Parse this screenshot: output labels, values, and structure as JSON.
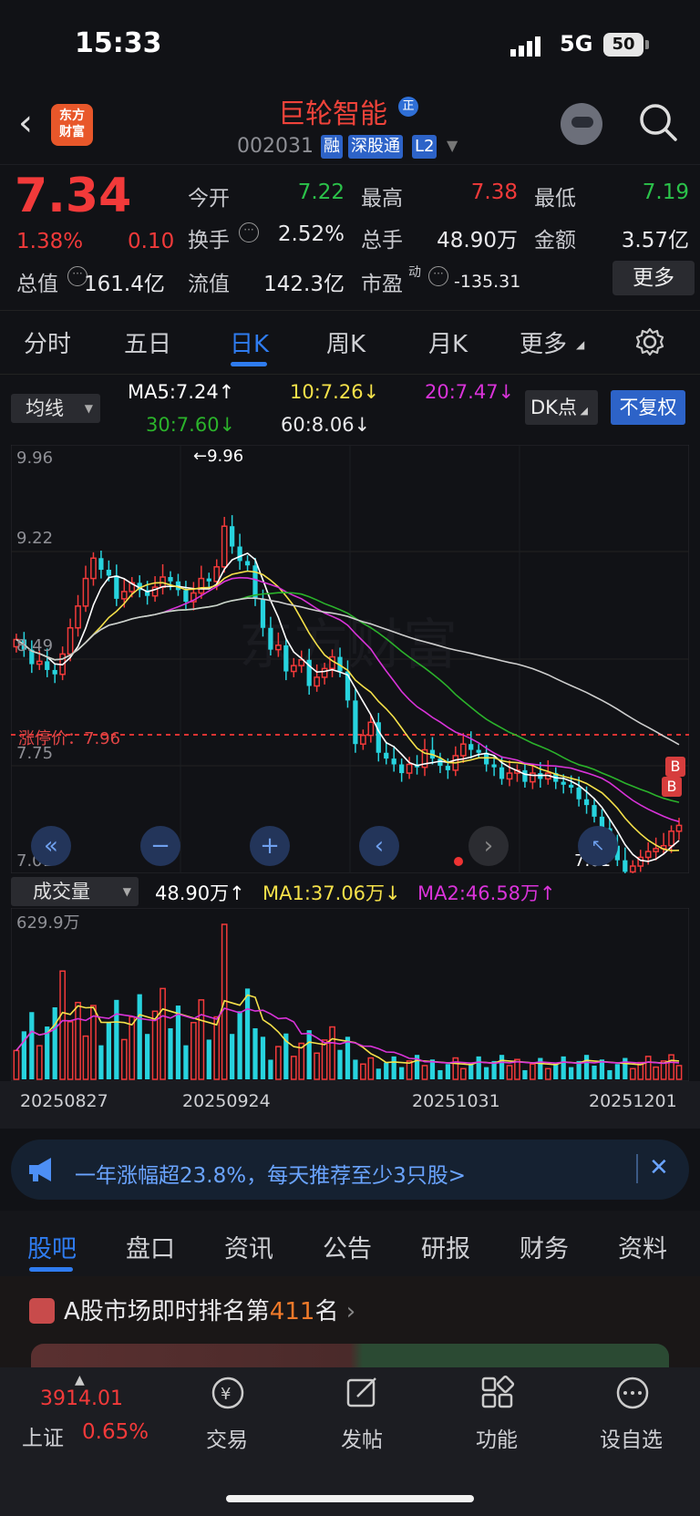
{
  "status_bar": {
    "time": "15:33",
    "network": "5G",
    "battery": "50"
  },
  "header": {
    "logo_text": "东方\n财富",
    "stock_name": "巨轮智能",
    "stock_code": "002031",
    "tags": [
      "融",
      "深股通",
      "L2"
    ],
    "badge": "正"
  },
  "quote": {
    "price": "7.34",
    "pct_change": "1.38%",
    "change": "0.10",
    "open_label": "今开",
    "open": "7.22",
    "high_label": "最高",
    "high": "7.38",
    "low_label": "最低",
    "low": "7.19",
    "turnover_label": "换手",
    "turnover": "2.52%",
    "volume_label": "总手",
    "volume": "48.90万",
    "amount_label": "金额",
    "amount": "3.57亿",
    "mktcap_label": "总值",
    "mktcap": "161.4亿",
    "float_label": "流值",
    "float_cap": "142.3亿",
    "pe_label": "市盈",
    "pe_sup": "动",
    "pe": "-135.31",
    "more_label": "更多"
  },
  "chart_tabs": [
    "分时",
    "五日",
    "日K",
    "周K",
    "月K",
    "更多"
  ],
  "ma_bar": {
    "selector": "均线",
    "ma5": "MA5:7.24↑",
    "ma10": "10:7.26↓",
    "ma20": "20:7.47↓",
    "ma30": "30:7.60↓",
    "ma60": "60:8.06↓",
    "dk_label": "DK点",
    "adjust_label": "不复权"
  },
  "kline": {
    "y_ticks": [
      "9.96",
      "9.22",
      "8.49",
      "7.75",
      "7.01"
    ],
    "max_label": "←9.96",
    "min_label": "7.01",
    "limit_label": "涨停价：7.96",
    "markers": [
      "B",
      "B"
    ]
  },
  "volume_bar": {
    "selector": "成交量",
    "vol": "48.90万↑",
    "ma1": "MA1:37.06万↓",
    "ma2": "MA2:46.58万↑",
    "y_top": "629.9万"
  },
  "date_labels": [
    "20250827",
    "20250924",
    "20251031",
    "20251201"
  ],
  "colors": {
    "up": "#f23a3a",
    "down": "#27d3de",
    "ma5": "#ffffff",
    "ma10": "#f5e14a",
    "ma20": "#d933d9",
    "ma30": "#2bb32b",
    "ma60": "#cfcfcf",
    "accent": "#2f7cf0"
  },
  "ad": {
    "text": "一年涨幅超23.8%，每天推荐至少3只股>"
  },
  "bottom_tabs": [
    "股吧",
    "盘口",
    "资讯",
    "公告",
    "研报",
    "财务",
    "资料"
  ],
  "rank": {
    "prefix": "A股市场即时排名第",
    "number": "411",
    "suffix": "名"
  },
  "nav": {
    "index_value": "3914.01",
    "index_name": "上证",
    "index_pct": "0.65%",
    "items": [
      "交易",
      "发帖",
      "功能",
      "设自选"
    ]
  }
}
